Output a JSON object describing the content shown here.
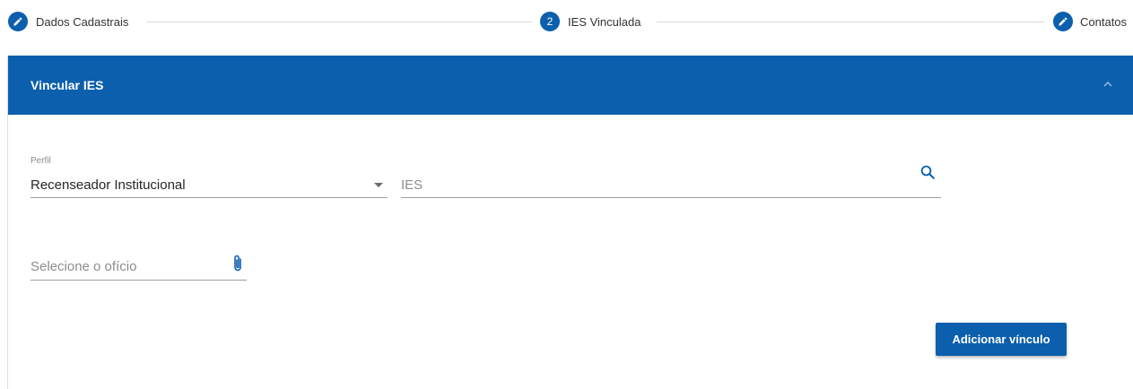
{
  "stepper": {
    "steps": [
      {
        "label": "Dados Cadastrais",
        "marker": "edit-icon"
      },
      {
        "label": "IES Vinculada",
        "marker": "2"
      },
      {
        "label": "Contatos",
        "marker": "edit-icon"
      }
    ]
  },
  "panel": {
    "title": "Vincular IES",
    "collapse_icon": "chevron-up-icon"
  },
  "form": {
    "perfil": {
      "label": "Perfil",
      "value": "Recenseador Institucional",
      "icon": "dropdown-arrow-icon"
    },
    "ies": {
      "placeholder": "IES",
      "icon": "search-icon"
    },
    "oficio": {
      "placeholder": "Selecione o ofício",
      "icon": "paperclip-icon"
    },
    "submit_label": "Adicionar vínculo"
  },
  "colors": {
    "primary": "#0b5fad",
    "divider": "#d9d9d9"
  }
}
